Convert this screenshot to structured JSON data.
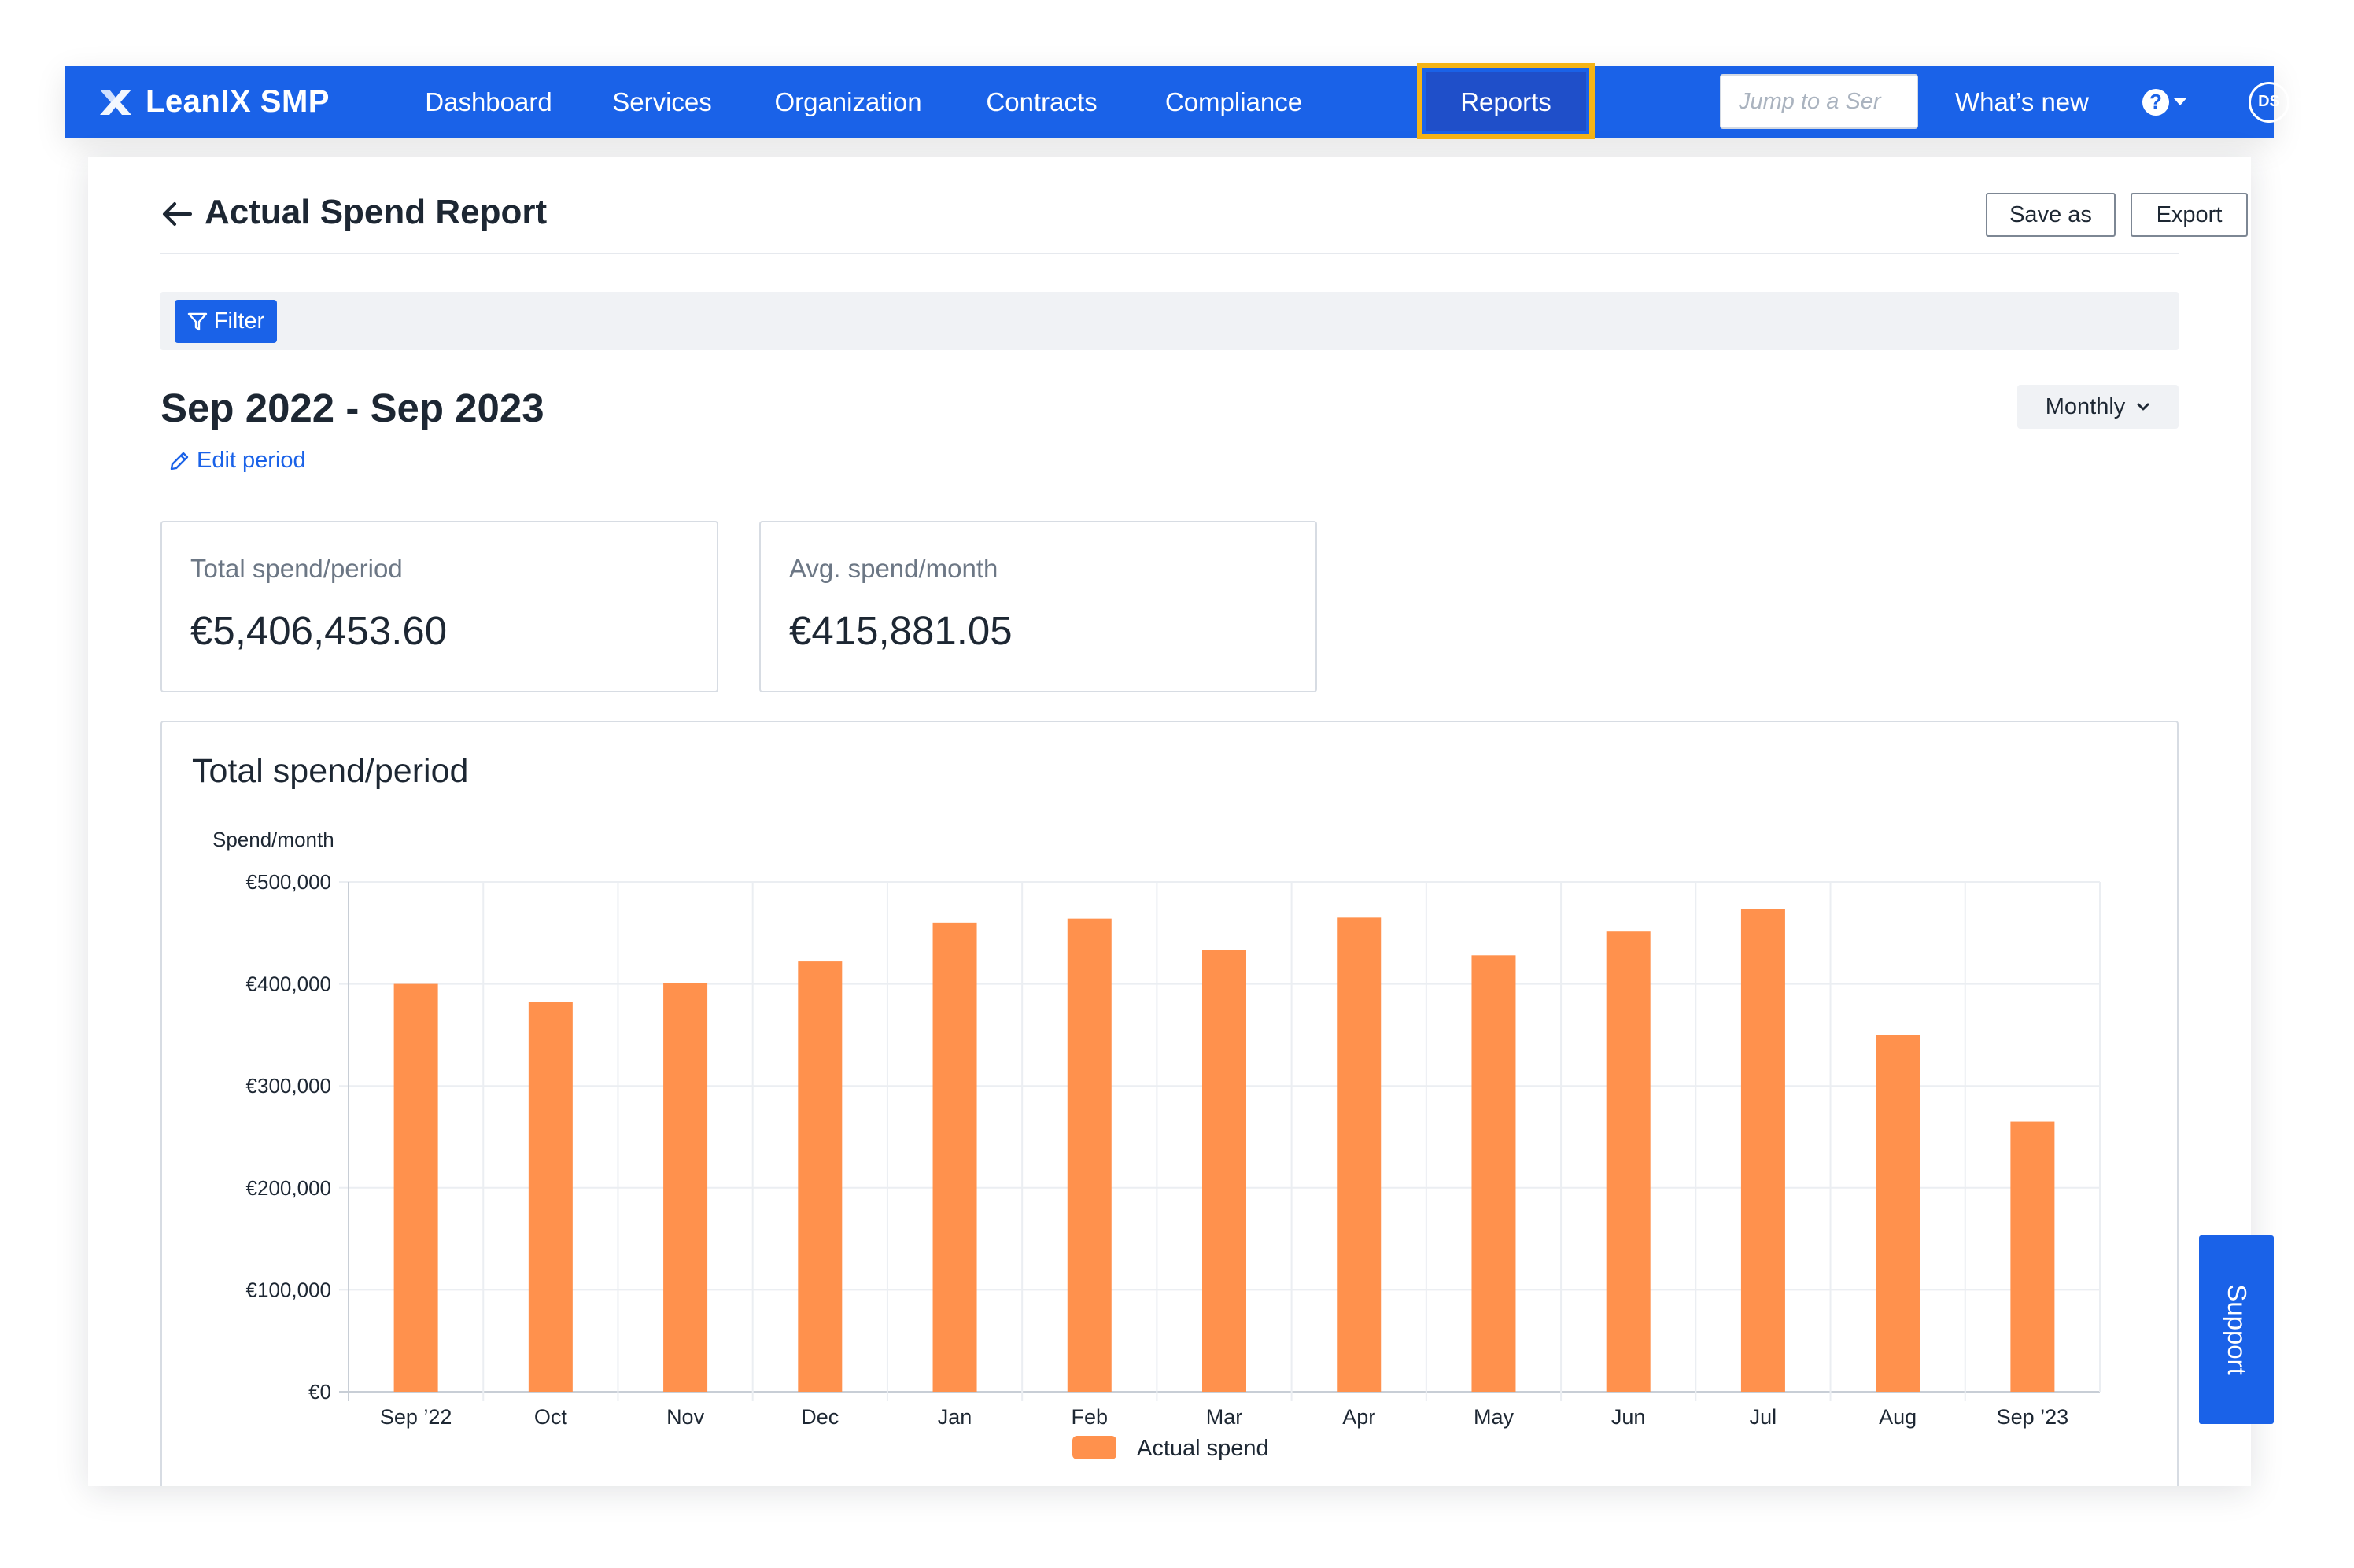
{
  "app": {
    "brand": "LeanIX SMP"
  },
  "nav": {
    "items": [
      {
        "label": "Dashboard"
      },
      {
        "label": "Services"
      },
      {
        "label": "Organization"
      },
      {
        "label": "Contracts"
      },
      {
        "label": "Compliance"
      },
      {
        "label": "Reports",
        "active": true
      }
    ],
    "jump_placeholder": "Jump to a Ser",
    "whats_new": "What’s new",
    "help_icon": "question-circle-icon",
    "avatar_initials": "DS"
  },
  "page": {
    "title": "Actual Spend Report",
    "save_as": "Save as",
    "export": "Export",
    "filter_label": "Filter",
    "period_title": "Sep 2022 - Sep 2023",
    "edit_period": "Edit period",
    "granularity": "Monthly"
  },
  "stats": [
    {
      "label": "Total spend/period",
      "value": "€5,406,453.60"
    },
    {
      "label": "Avg. spend/month",
      "value": "€415,881.05"
    }
  ],
  "support": {
    "label": "Support"
  },
  "colors": {
    "brand": "#1a62e8",
    "highlight": "#f5b415",
    "bar": "#ff914d"
  },
  "chart_data": {
    "type": "bar",
    "title": "Total spend/period",
    "ylabel": "Spend/month",
    "categories": [
      "Sep ’22",
      "Oct",
      "Nov",
      "Dec",
      "Jan",
      "Feb",
      "Mar",
      "Apr",
      "May",
      "Jun",
      "Jul",
      "Aug",
      "Sep ’23"
    ],
    "series": [
      {
        "name": "Actual spend",
        "values": [
          400000,
          382000,
          401000,
          422000,
          460000,
          464000,
          433000,
          465000,
          428000,
          452000,
          473000,
          350000,
          265000
        ]
      }
    ],
    "ylim": [
      0,
      500000
    ],
    "yticks": [
      0,
      100000,
      200000,
      300000,
      400000,
      500000
    ],
    "ytick_labels": [
      "€0",
      "€100,000",
      "€200,000",
      "€300,000",
      "€400,000",
      "€500,000"
    ],
    "grid": true,
    "legend": "bottom-center"
  }
}
